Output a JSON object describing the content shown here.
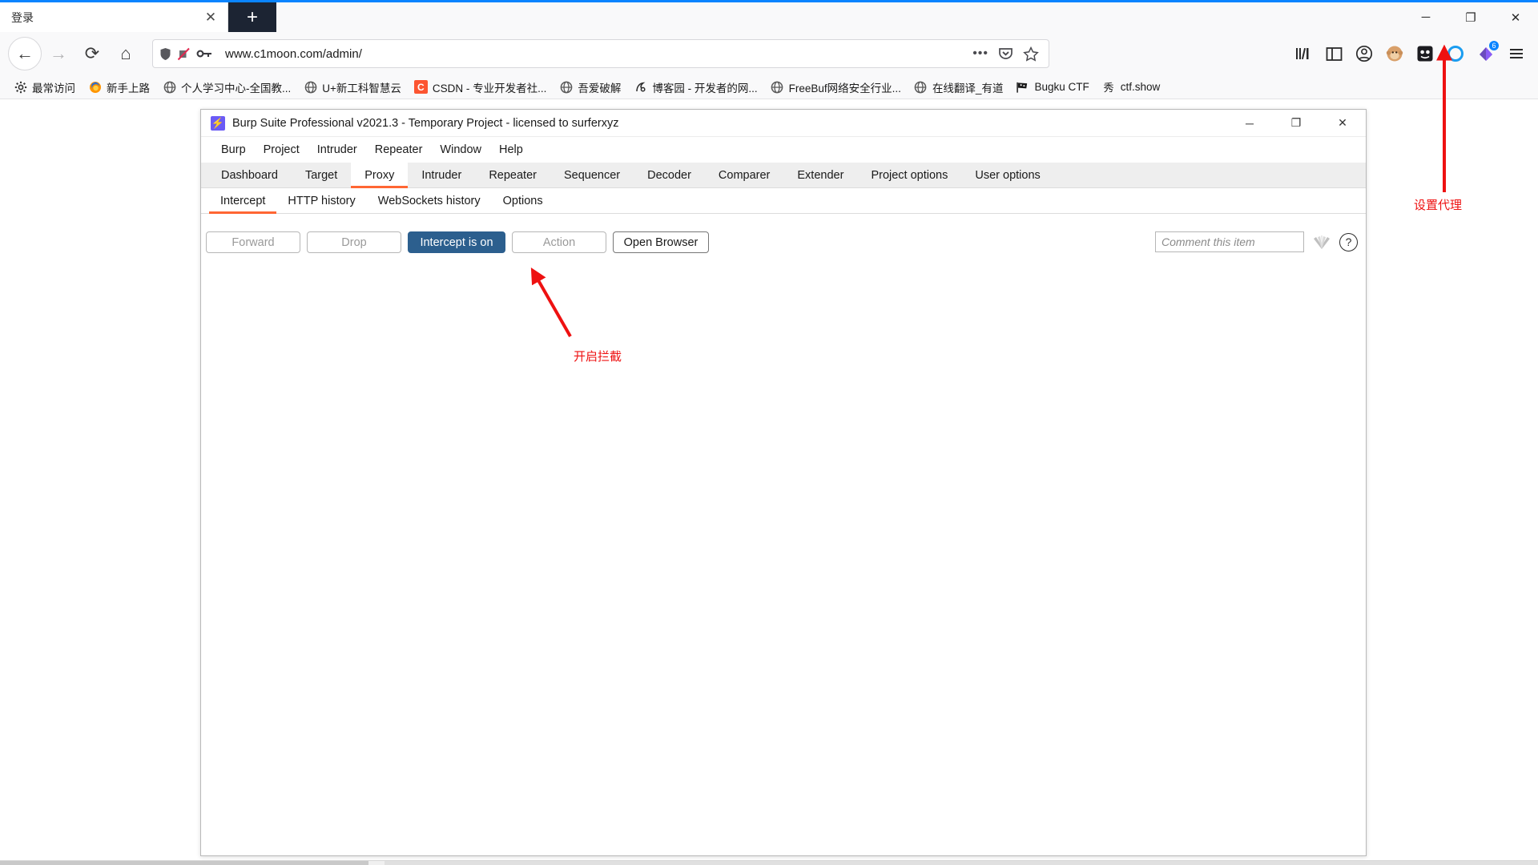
{
  "browser": {
    "tab": {
      "title": "登录",
      "close_icon": "close-icon"
    },
    "newtab_label": "+",
    "window_controls": {
      "minimize": "─",
      "maximize": "❐",
      "close": "✕"
    },
    "nav": {
      "back": "←",
      "forward": "→",
      "reload": "⟳",
      "home": "⌂"
    },
    "url": {
      "value": "www.c1moon.com/admin/",
      "shield_icon": "shield-icon",
      "tracking_icon": "tracking-protection-off-icon",
      "key_icon": "key-icon",
      "more_icon": "•••",
      "pocket_icon": "pocket-icon",
      "bookmark_icon": "star-icon"
    },
    "toolbar_icons": [
      {
        "name": "library-icon",
        "glyph": "⑃"
      },
      {
        "name": "sidebar-icon",
        "glyph": "▥"
      },
      {
        "name": "account-icon",
        "glyph": "◉"
      },
      {
        "name": "extension-monkey-icon",
        "glyph": "●"
      },
      {
        "name": "extension-dark-icon",
        "glyph": "▣"
      },
      {
        "name": "extension-blue-circle-icon",
        "glyph": "◯"
      },
      {
        "name": "extension-proxy-icon",
        "glyph": "◆",
        "badge": "6"
      },
      {
        "name": "app-menu-icon",
        "glyph": "☰"
      }
    ],
    "bookmarks": [
      {
        "label": "最常访问",
        "icon": "gear-icon"
      },
      {
        "label": "新手上路",
        "icon": "firefox-icon"
      },
      {
        "label": "个人学习中心-全国教...",
        "icon": "globe-icon"
      },
      {
        "label": "U+新工科智慧云",
        "icon": "globe-icon"
      },
      {
        "label": "CSDN - 专业开发者社...",
        "icon": "csdn-icon"
      },
      {
        "label": "吾爱破解",
        "icon": "globe-icon"
      },
      {
        "label": "博客园 - 开发者的网...",
        "icon": "cnblogs-icon"
      },
      {
        "label": "FreeBuf网络安全行业...",
        "icon": "globe-icon"
      },
      {
        "label": "在线翻译_有道",
        "icon": "globe-icon"
      },
      {
        "label": "Bugku CTF",
        "icon": "flag-icon"
      },
      {
        "label": "ctf.show",
        "icon": "ctfshow-icon"
      }
    ]
  },
  "burp": {
    "title": "Burp Suite Professional v2021.3 - Temporary Project - licensed to surferxyz",
    "logo_icon": "burp-logo-icon",
    "window_controls": {
      "minimize": "─",
      "maximize": "❐",
      "close": "✕"
    },
    "menu": [
      "Burp",
      "Project",
      "Intruder",
      "Repeater",
      "Window",
      "Help"
    ],
    "tabs": [
      {
        "label": "Dashboard",
        "active": false
      },
      {
        "label": "Target",
        "active": false
      },
      {
        "label": "Proxy",
        "active": true
      },
      {
        "label": "Intruder",
        "active": false
      },
      {
        "label": "Repeater",
        "active": false
      },
      {
        "label": "Sequencer",
        "active": false
      },
      {
        "label": "Decoder",
        "active": false
      },
      {
        "label": "Comparer",
        "active": false
      },
      {
        "label": "Extender",
        "active": false
      },
      {
        "label": "Project options",
        "active": false
      },
      {
        "label": "User options",
        "active": false
      }
    ],
    "subtabs": [
      {
        "label": "Intercept",
        "active": true
      },
      {
        "label": "HTTP history",
        "active": false
      },
      {
        "label": "WebSockets history",
        "active": false
      },
      {
        "label": "Options",
        "active": false
      }
    ],
    "buttons": [
      {
        "label": "Forward",
        "style": "disabled"
      },
      {
        "label": "Drop",
        "style": "disabled"
      },
      {
        "label": "Intercept is on",
        "style": "primary"
      },
      {
        "label": "Action",
        "style": "disabled"
      },
      {
        "label": "Open Browser",
        "style": "normal"
      }
    ],
    "comment": {
      "placeholder": "Comment this item",
      "shell_icon": "shell-icon",
      "help_icon": "help-icon",
      "help_glyph": "?"
    },
    "accent_color": "#ff6633",
    "primary_button_color": "#2c5f8e"
  },
  "annotations": {
    "color": "#ee1111",
    "items": [
      {
        "text": "设置代理",
        "name": "annotation-set-proxy"
      },
      {
        "text": "开启拦截",
        "name": "annotation-enable-intercept"
      }
    ]
  }
}
